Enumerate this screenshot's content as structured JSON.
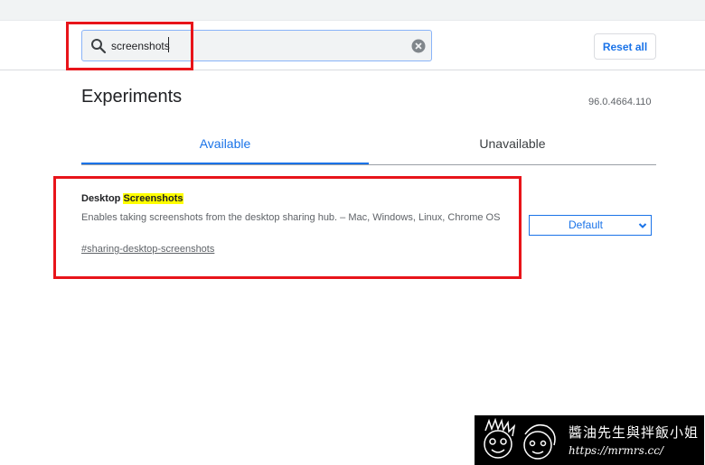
{
  "search": {
    "value": "screenshots",
    "icon": "search-icon",
    "clear_icon": "clear-icon"
  },
  "header": {
    "reset_label": "Reset all"
  },
  "page": {
    "title": "Experiments",
    "version": "96.0.4664.110"
  },
  "tabs": [
    {
      "label": "Available",
      "active": true
    },
    {
      "label": "Unavailable",
      "active": false
    }
  ],
  "experiment": {
    "name_prefix": "Desktop ",
    "name_highlight": "Screenshots",
    "description": "Enables taking screenshots from the desktop sharing hub. – Mac, Windows, Linux, Chrome OS",
    "link": "#sharing-desktop-screenshots",
    "selected_option": "Default"
  },
  "watermark": {
    "title": "醬油先生與拌飯小姐",
    "url": "https://mrmrs.cc/"
  },
  "colors": {
    "accent": "#1a73e8",
    "annotation_red": "#e8141a",
    "highlight": "#ffff00"
  }
}
